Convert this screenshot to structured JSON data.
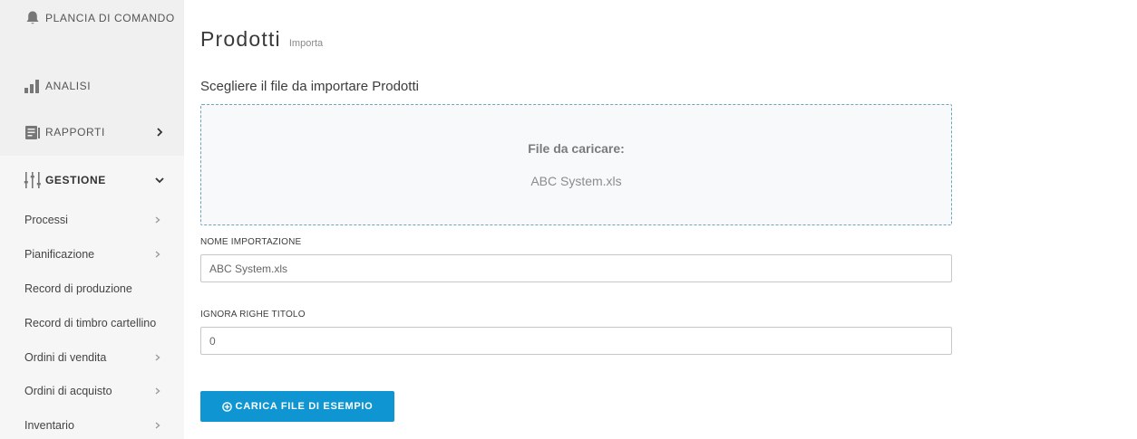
{
  "sidebar": {
    "top_items": [
      {
        "label": "PLANCIA DI COMANDO",
        "icon": "bell-icon"
      },
      {
        "label": "ANALISI",
        "icon": "bar-chart-icon"
      },
      {
        "label": "RAPPORTI",
        "icon": "report-icon"
      },
      {
        "label": "GESTIONE",
        "icon": "sliders-icon"
      }
    ],
    "sub_items": [
      {
        "label": "Processi",
        "has_chevron": true
      },
      {
        "label": "Pianificazione",
        "has_chevron": true
      },
      {
        "label": "Record di produzione",
        "has_chevron": false
      },
      {
        "label": "Record di timbro cartellino",
        "has_chevron": false
      },
      {
        "label": "Ordini di vendita",
        "has_chevron": true
      },
      {
        "label": "Ordini di acquisto",
        "has_chevron": true
      },
      {
        "label": "Inventario",
        "has_chevron": true
      }
    ]
  },
  "main": {
    "title": "Prodotti",
    "subtitle": "Importa",
    "section_title": "Scegliere il file da importare Prodotti",
    "dropzone": {
      "label": "File da caricare:",
      "file_name": "ABC System.xls"
    },
    "import_name": {
      "label": "NOME IMPORTAZIONE",
      "value": "ABC System.xls"
    },
    "ignore_rows": {
      "label": "IGNORA RIGHE TITOLO",
      "value": "0"
    },
    "upload_button": {
      "label": "CARICA FILE DI ESEMPIO",
      "icon": "plus-circle-icon"
    }
  },
  "colors": {
    "accent": "#0f96d2",
    "dropzone_border": "#6aa5c4",
    "sidebar_bg": "#f0f0f0"
  }
}
